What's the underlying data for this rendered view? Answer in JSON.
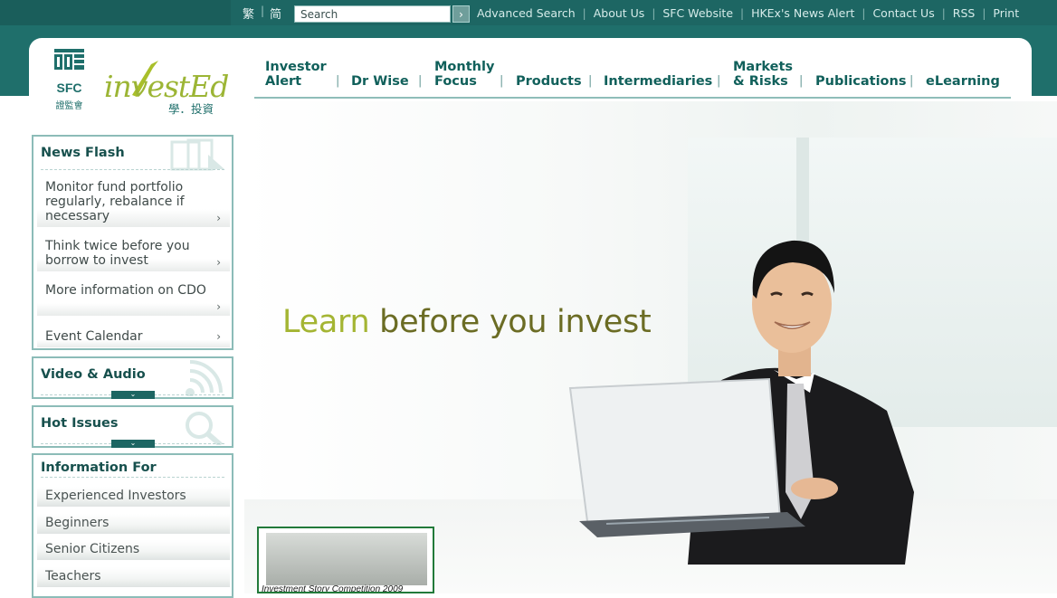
{
  "colors": {
    "brand_teal": "#1d6663",
    "nav_text": "#11605b",
    "border": "#8cbcb8",
    "tag_light": "#a4b533",
    "tag_dark": "#6b6c24"
  },
  "topbar": {
    "lang_traditional": "繁",
    "lang_simplified": "简",
    "lang_separator": "|",
    "search_placeholder": "Search",
    "search_go_label": "›",
    "links": [
      "Advanced Search",
      "About Us",
      "SFC Website",
      "HKEx's News Alert",
      "Contact Us",
      "RSS",
      "Print"
    ],
    "link_separator": "|"
  },
  "logos": {
    "sfc_text": "SFC",
    "sfc_chinese": "證監會",
    "invested_text": "investEd",
    "invested_chinese": "學．投資"
  },
  "nav": {
    "items": [
      {
        "line1": "Investor",
        "line2": "Alert"
      },
      {
        "line1": "",
        "line2": "Dr Wise"
      },
      {
        "line1": "Monthly",
        "line2": "Focus"
      },
      {
        "line1": "",
        "line2": "Products"
      },
      {
        "line1": "",
        "line2": "Intermediaries"
      },
      {
        "line1": "Markets",
        "line2": "& Risks"
      },
      {
        "line1": "",
        "line2": "Publications"
      },
      {
        "line1": "",
        "line2": "eLearning"
      }
    ],
    "separator": "|"
  },
  "sidebar": {
    "news_flash": {
      "title": "News Flash",
      "items": [
        "Monitor fund portfolio regularly, rebalance if necessary",
        "Think twice before you borrow to invest",
        "More information on CDO",
        "Event Calendar"
      ],
      "arrow": "›"
    },
    "video_audio": {
      "title": "Video & Audio",
      "expand": "⌄"
    },
    "hot_issues": {
      "title": "Hot Issues",
      "expand": "⌄"
    },
    "information_for": {
      "title": "Information For",
      "items": [
        "Experienced Investors",
        "Beginners",
        "Senior Citizens",
        "Teachers"
      ]
    }
  },
  "hero": {
    "tagline_part1": "Learn",
    "tagline_part2": "before you invest"
  },
  "promo": {
    "caption": "Investment Story Competition 2009"
  }
}
